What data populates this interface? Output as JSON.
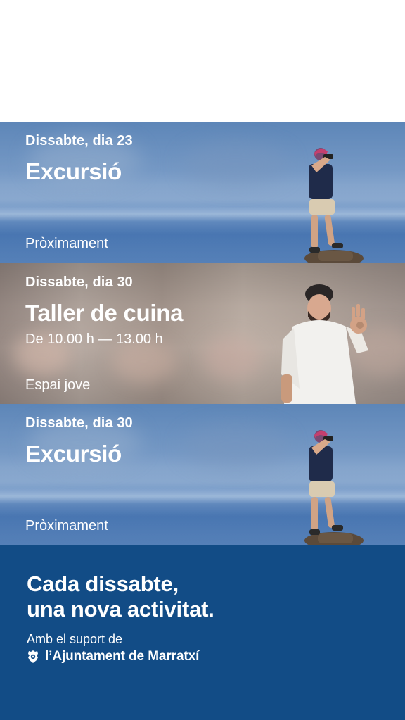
{
  "events": [
    {
      "date": "Dissabte, dia 23",
      "title": "Excursió",
      "time": "",
      "footer": "Pròximament",
      "image": "photographer-on-rock"
    },
    {
      "date": "Dissabte, dia 30",
      "title": "Taller de cuina",
      "time": "De 10.00 h — 13.00 h",
      "footer": "Espai jove",
      "image": "chef-ok-gesture"
    },
    {
      "date": "Dissabte, dia 30",
      "title": "Excursió",
      "time": "",
      "footer": "Pròximament",
      "image": "photographer-on-rock"
    }
  ],
  "promo": {
    "headline_line1": "Cada dissabte,",
    "headline_line2": "una nova activitat.",
    "support_text": "Amb el suport de",
    "org_name": "l’Ajuntament de Marratxí",
    "org_icon": "coat-of-arms-icon"
  },
  "colors": {
    "panel_blue": "#124c86",
    "sky_blue": "#6f94c2",
    "text": "#ffffff"
  }
}
